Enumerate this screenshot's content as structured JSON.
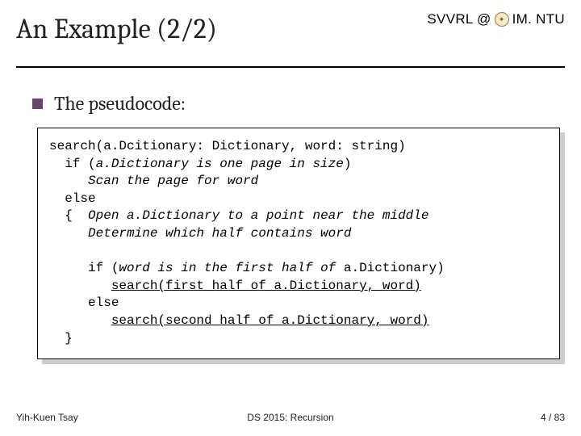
{
  "header": {
    "title": "An Example (2/2)",
    "brand_left": "SVVRL @",
    "brand_right": "IM. NTU"
  },
  "bullet": {
    "text": "The pseudocode:"
  },
  "code": {
    "l1a": "search",
    "l1b": "(a.Dcitionary: Dictionary, word: string)",
    "l2a": "  if (",
    "l2b": "a.Dictionary is one page in size",
    "l2c": ")",
    "l3": "     Scan the page for word",
    "l4": "  else",
    "l5a": "  {  ",
    "l5b": "Open a.Dictionary to a point near the middle",
    "l6": "     Determine which half contains word",
    "blank1": " ",
    "l7a": "     if (",
    "l7b": "word is in the first half of ",
    "l7c": "a.Dictionary)",
    "l8a": "        ",
    "l8b": "search",
    "l8c": "(first half of ",
    "l8d": "a.Dictionary, word)",
    "l9": "     else",
    "l10a": "        ",
    "l10b": "search",
    "l10c": "(second half of ",
    "l10d": "a.Dictionary, word)",
    "l11": "  }"
  },
  "footer": {
    "left": "Yih-Kuen Tsay",
    "center": "DS 2015: Recursion",
    "right": "4 / 83"
  }
}
